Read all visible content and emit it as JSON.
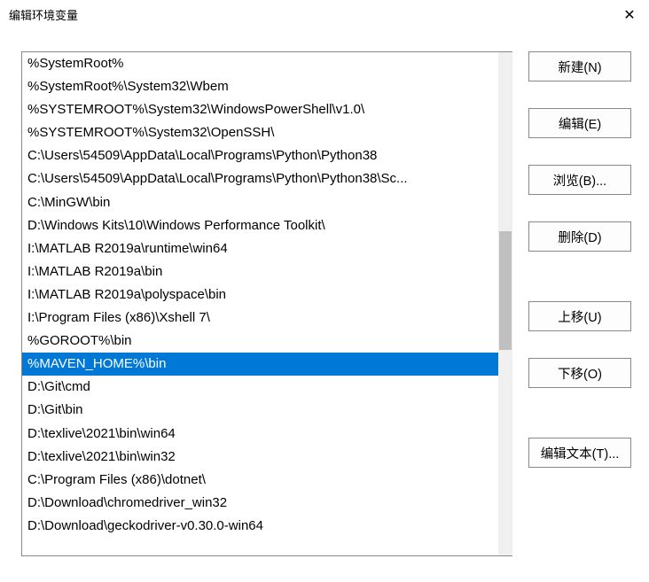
{
  "window": {
    "title": "编辑环境变量"
  },
  "list": {
    "selected_index": 13,
    "items": [
      "%SystemRoot%",
      "%SystemRoot%\\System32\\Wbem",
      "%SYSTEMROOT%\\System32\\WindowsPowerShell\\v1.0\\",
      "%SYSTEMROOT%\\System32\\OpenSSH\\",
      "C:\\Users\\54509\\AppData\\Local\\Programs\\Python\\Python38",
      "C:\\Users\\54509\\AppData\\Local\\Programs\\Python\\Python38\\Sc...",
      "C:\\MinGW\\bin",
      "D:\\Windows Kits\\10\\Windows Performance Toolkit\\",
      "I:\\MATLAB R2019a\\runtime\\win64",
      "I:\\MATLAB R2019a\\bin",
      "I:\\MATLAB R2019a\\polyspace\\bin",
      "I:\\Program Files (x86)\\Xshell 7\\",
      "%GOROOT%\\bin",
      "%MAVEN_HOME%\\bin",
      "D:\\Git\\cmd",
      "D:\\Git\\bin",
      "D:\\texlive\\2021\\bin\\win64",
      "D:\\texlive\\2021\\bin\\win32",
      "C:\\Program Files (x86)\\dotnet\\",
      "D:\\Download\\chromedriver_win32",
      "D:\\Download\\geckodriver-v0.30.0-win64"
    ]
  },
  "buttons": {
    "new": "新建(N)",
    "edit": "编辑(E)",
    "browse": "浏览(B)...",
    "delete": "删除(D)",
    "move_up": "上移(U)",
    "move_down": "下移(O)",
    "edit_text": "编辑文本(T)..."
  }
}
